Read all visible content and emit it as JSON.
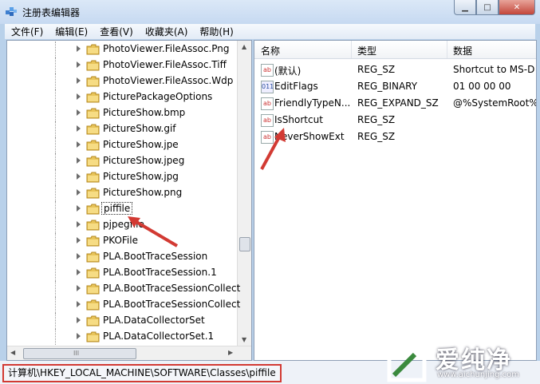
{
  "window": {
    "title": "注册表编辑器",
    "controls": {
      "minimize": "▁",
      "maximize": "□",
      "close": "✕"
    }
  },
  "menu": [
    "文件(F)",
    "编辑(E)",
    "查看(V)",
    "收藏夹(A)",
    "帮助(H)"
  ],
  "tree": {
    "items": [
      {
        "label": "PhotoViewer.FileAssoc.Png"
      },
      {
        "label": "PhotoViewer.FileAssoc.Tiff"
      },
      {
        "label": "PhotoViewer.FileAssoc.Wdp"
      },
      {
        "label": "PicturePackageOptions"
      },
      {
        "label": "PictureShow.bmp"
      },
      {
        "label": "PictureShow.gif"
      },
      {
        "label": "PictureShow.jpe"
      },
      {
        "label": "PictureShow.jpeg"
      },
      {
        "label": "PictureShow.jpg"
      },
      {
        "label": "PictureShow.png"
      },
      {
        "label": "piffile",
        "selected": true
      },
      {
        "label": "pjpegfile"
      },
      {
        "label": "PKOFile"
      },
      {
        "label": "PLA.BootTraceSession"
      },
      {
        "label": "PLA.BootTraceSession.1"
      },
      {
        "label": "PLA.BootTraceSessionCollect"
      },
      {
        "label": "PLA.BootTraceSessionCollect"
      },
      {
        "label": "PLA.DataCollectorSet"
      },
      {
        "label": "PLA.DataCollectorSet.1"
      }
    ],
    "folder_icon": "folder-icon",
    "hscroll_grip": "III"
  },
  "values": {
    "headers": {
      "name": "名称",
      "type": "类型",
      "data": "数据"
    },
    "rows": [
      {
        "icon": "ab",
        "name": "(默认)",
        "type": "REG_SZ",
        "data": "Shortcut to MS-D"
      },
      {
        "icon": "011",
        "name": "EditFlags",
        "type": "REG_BINARY",
        "data": "01 00 00 00"
      },
      {
        "icon": "ab",
        "name": "FriendlyTypeN...",
        "type": "REG_EXPAND_SZ",
        "data": "@%SystemRoot%"
      },
      {
        "icon": "ab",
        "name": "IsShortcut",
        "type": "REG_SZ",
        "data": ""
      },
      {
        "icon": "ab",
        "name": "NeverShowExt",
        "type": "REG_SZ",
        "data": ""
      }
    ]
  },
  "status": {
    "path": "计算机\\HKEY_LOCAL_MACHINE\\SOFTWARE\\Classes\\piffile"
  },
  "watermark": {
    "text": "爱纯净",
    "url": "www.aichunjing.com"
  },
  "colors": {
    "highlight": "#d23a33",
    "pane_border": "#8e9fb6"
  }
}
